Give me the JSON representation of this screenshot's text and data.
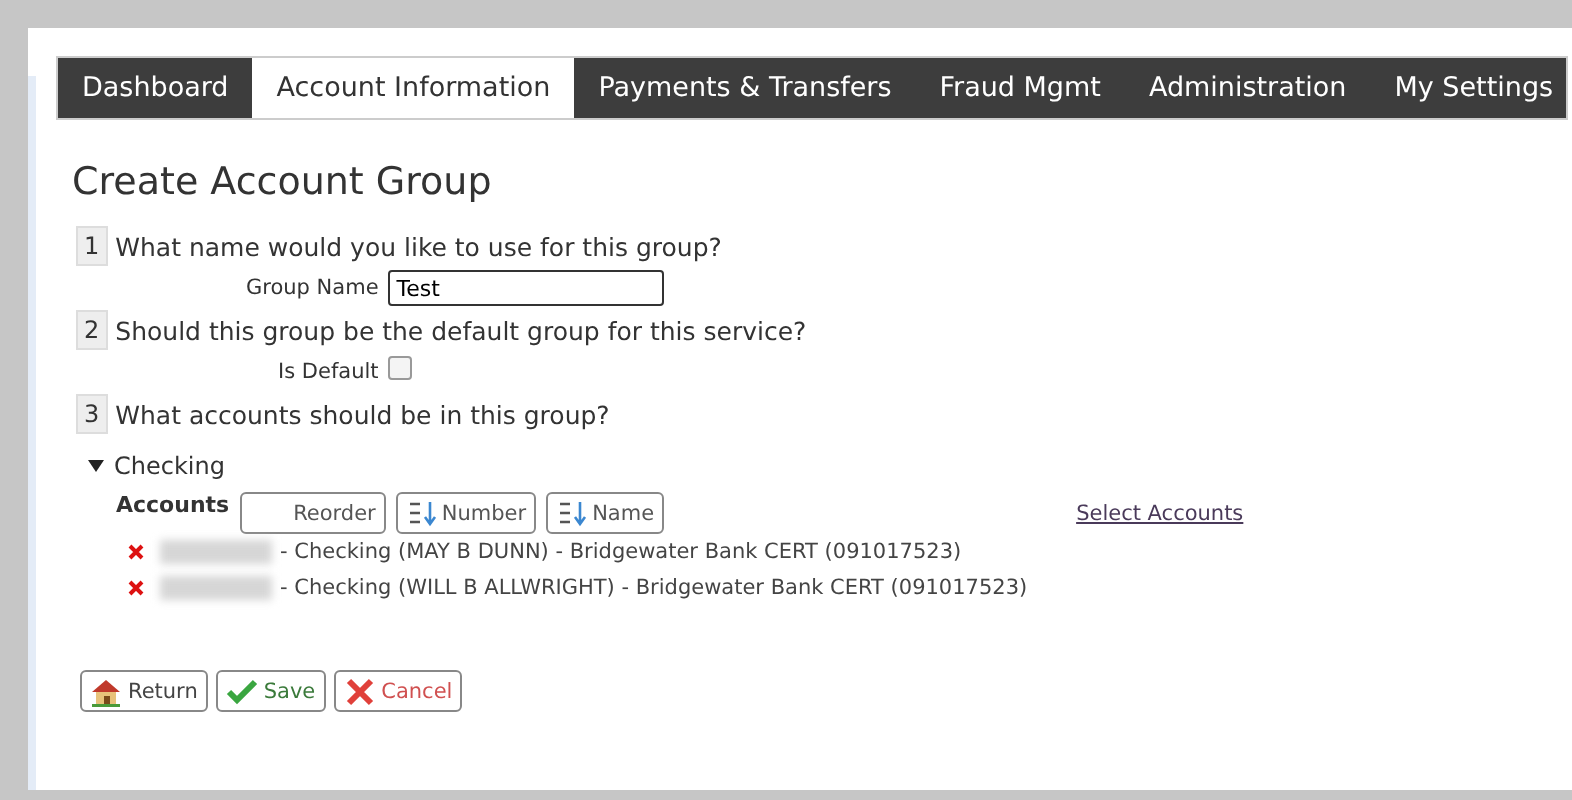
{
  "tabs": [
    {
      "label": "Dashboard",
      "selected": false
    },
    {
      "label": "Account Information",
      "selected": true
    },
    {
      "label": "Payments & Transfers",
      "selected": false
    },
    {
      "label": "Fraud Mgmt",
      "selected": false
    },
    {
      "label": "Administration",
      "selected": false
    },
    {
      "label": "My Settings",
      "selected": false
    }
  ],
  "page_title": "Create Account Group",
  "steps": [
    {
      "number": "1",
      "question": "What name would you like to use for this group?",
      "field": {
        "kind": "text",
        "label": "Group Name",
        "value": "Test"
      }
    },
    {
      "number": "2",
      "question": "Should this group be the default group for this service?",
      "field": {
        "kind": "checkbox",
        "label": "Is Default",
        "checked": false
      }
    },
    {
      "number": "3",
      "question": "What accounts should be in this group?"
    }
  ],
  "group": {
    "label": "Checking",
    "expanded": true,
    "accounts_label": "Accounts",
    "sort_buttons": [
      {
        "kind": "plain",
        "label": "Reorder"
      },
      {
        "kind": "sort",
        "label": "Number"
      },
      {
        "kind": "sort",
        "label": "Name"
      }
    ],
    "select_link": "Select Accounts",
    "accounts": [
      {
        "description": "- Checking (MAY B DUNN) - Bridgewater Bank CERT (091017523)"
      },
      {
        "description": "- Checking (WILL B ALLWRIGHT) - Bridgewater Bank CERT (091017523)"
      }
    ]
  },
  "actions": [
    {
      "kind": "return",
      "label": "Return"
    },
    {
      "kind": "save",
      "label": "Save"
    },
    {
      "kind": "cancel",
      "label": "Cancel"
    }
  ]
}
